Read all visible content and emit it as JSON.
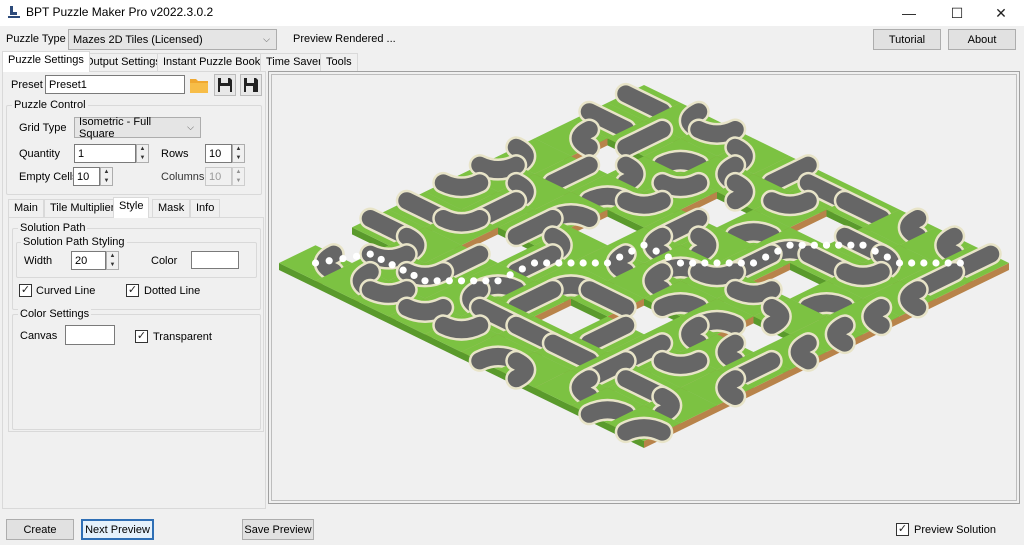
{
  "window": {
    "title": "BPT Puzzle Maker Pro v2022.3.0.2",
    "app_icon": "bpt-app-icon",
    "controls": {
      "minimize": "—",
      "maximize": "☐",
      "close": "✕"
    }
  },
  "toolbar": {
    "puzzle_type_label": "Puzzle Type",
    "puzzle_type_value": "Mazes 2D Tiles (Licensed)",
    "status_text": "Preview Rendered ...",
    "tutorial_label": "Tutorial",
    "about_label": "About"
  },
  "main_tabs": [
    {
      "label": "Puzzle Settings",
      "active": true
    },
    {
      "label": "Output Settings",
      "active": false
    },
    {
      "label": "Instant Puzzle Books",
      "active": false
    },
    {
      "label": "Time Saver",
      "active": false
    },
    {
      "label": "Tools",
      "active": false
    }
  ],
  "preset": {
    "label": "Preset",
    "value": "Preset1",
    "icons": [
      "folder-open-icon",
      "save-icon",
      "save-as-icon"
    ]
  },
  "puzzle_control": {
    "title": "Puzzle Control",
    "grid_type_label": "Grid Type",
    "grid_type_value": "Isometric - Full Square",
    "quantity_label": "Quantity",
    "quantity_value": "1",
    "rows_label": "Rows",
    "rows_value": "10",
    "empty_cells_label": "Empty Cells",
    "empty_cells_value": "10",
    "columns_label": "Columns",
    "columns_value": "10"
  },
  "sub_tabs": [
    {
      "label": "Main",
      "active": false
    },
    {
      "label": "Tile Multiplier",
      "active": false
    },
    {
      "label": "Style",
      "active": true
    },
    {
      "label": "Mask",
      "active": false
    },
    {
      "label": "Info",
      "active": false
    }
  ],
  "style": {
    "solution_path_title": "Solution Path",
    "solution_path_styling_title": "Solution Path Styling",
    "width_label": "Width",
    "width_value": "20",
    "color_label": "Color",
    "color_value": "#ffffff",
    "curved_line_label": "Curved Line",
    "curved_line_checked": true,
    "dotted_line_label": "Dotted Line",
    "dotted_line_checked": true,
    "color_settings_title": "Color Settings",
    "canvas_label": "Canvas",
    "canvas_value": "#ffffff",
    "transparent_label": "Transparent",
    "transparent_checked": true
  },
  "preview": {
    "grid": {
      "rows": 10,
      "columns": 10,
      "empty_cells": 10
    },
    "colors": {
      "grass": "#7cc242",
      "grass_side": "#5a9a2c",
      "dirt_side": "#b8834a",
      "road": "#666666",
      "road_edge": "#e8e4c8",
      "solution_dots": "#ffffff",
      "background": "#f0f0f0"
    },
    "empty_cells": [
      [
        2,
        1
      ],
      [
        4,
        3
      ],
      [
        1,
        6
      ],
      [
        3,
        7
      ],
      [
        6,
        2
      ],
      [
        7,
        5
      ],
      [
        5,
        8
      ],
      [
        8,
        0
      ],
      [
        2,
        4
      ],
      [
        6,
        6
      ]
    ]
  },
  "bottom": {
    "create_label": "Create",
    "next_preview_label": "Next Preview",
    "save_preview_label": "Save Preview",
    "preview_solution_label": "Preview Solution",
    "preview_solution_checked": true
  }
}
